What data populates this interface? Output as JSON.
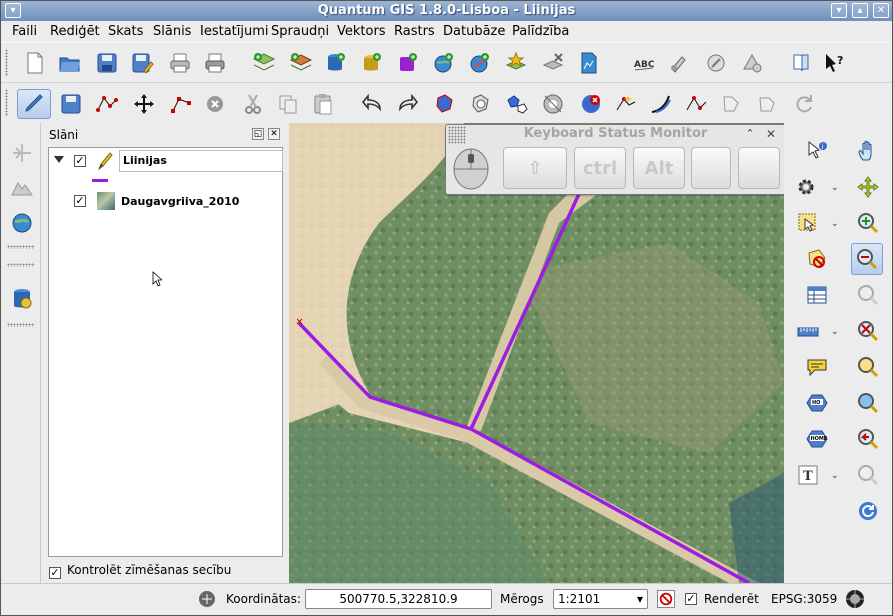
{
  "window": {
    "title": "Quantum GIS 1.8.0-Lisboa - Liinijas"
  },
  "menubar": {
    "items": [
      {
        "label": "Faile",
        "display": "Faile"
      },
      {
        "label": "Rediģēt"
      },
      {
        "label": "Skats"
      },
      {
        "label": "Slānis"
      },
      {
        "label": "Iestatījumi"
      },
      {
        "label": "Spraudņi"
      },
      {
        "label": "Vektors"
      },
      {
        "label": "Rastrs"
      },
      {
        "label": "Datubāze"
      },
      {
        "label": "Palīdzība"
      }
    ]
  },
  "layers_panel": {
    "title": "Slāni",
    "layers": [
      {
        "name": "Liinijas",
        "checked": true,
        "type": "vector-line",
        "style_color": "#9a1ee0"
      },
      {
        "name": "Daugavgriiva_2010",
        "checked": true,
        "type": "raster"
      }
    ],
    "render_order_label": "Kontrolēt zīmēšanas secību",
    "render_order_checked": true
  },
  "keyboard_monitor": {
    "title": "Keyboard Status Monitor",
    "keys": [
      "⇧",
      "ctrl",
      "Alt",
      "",
      ""
    ]
  },
  "statusbar": {
    "coords_label": "Koordinātas:",
    "coords_value": "500770.5,322810.9",
    "scale_label": "Mērogs",
    "scale_value": "1:2101",
    "render_label": "Renderēt",
    "render_checked": true,
    "epsg": "EPSG:3059"
  },
  "colors": {
    "line_feature": "#9a1ee0",
    "sand": "#e6d3b0",
    "vegetation": "#6e8d62"
  }
}
